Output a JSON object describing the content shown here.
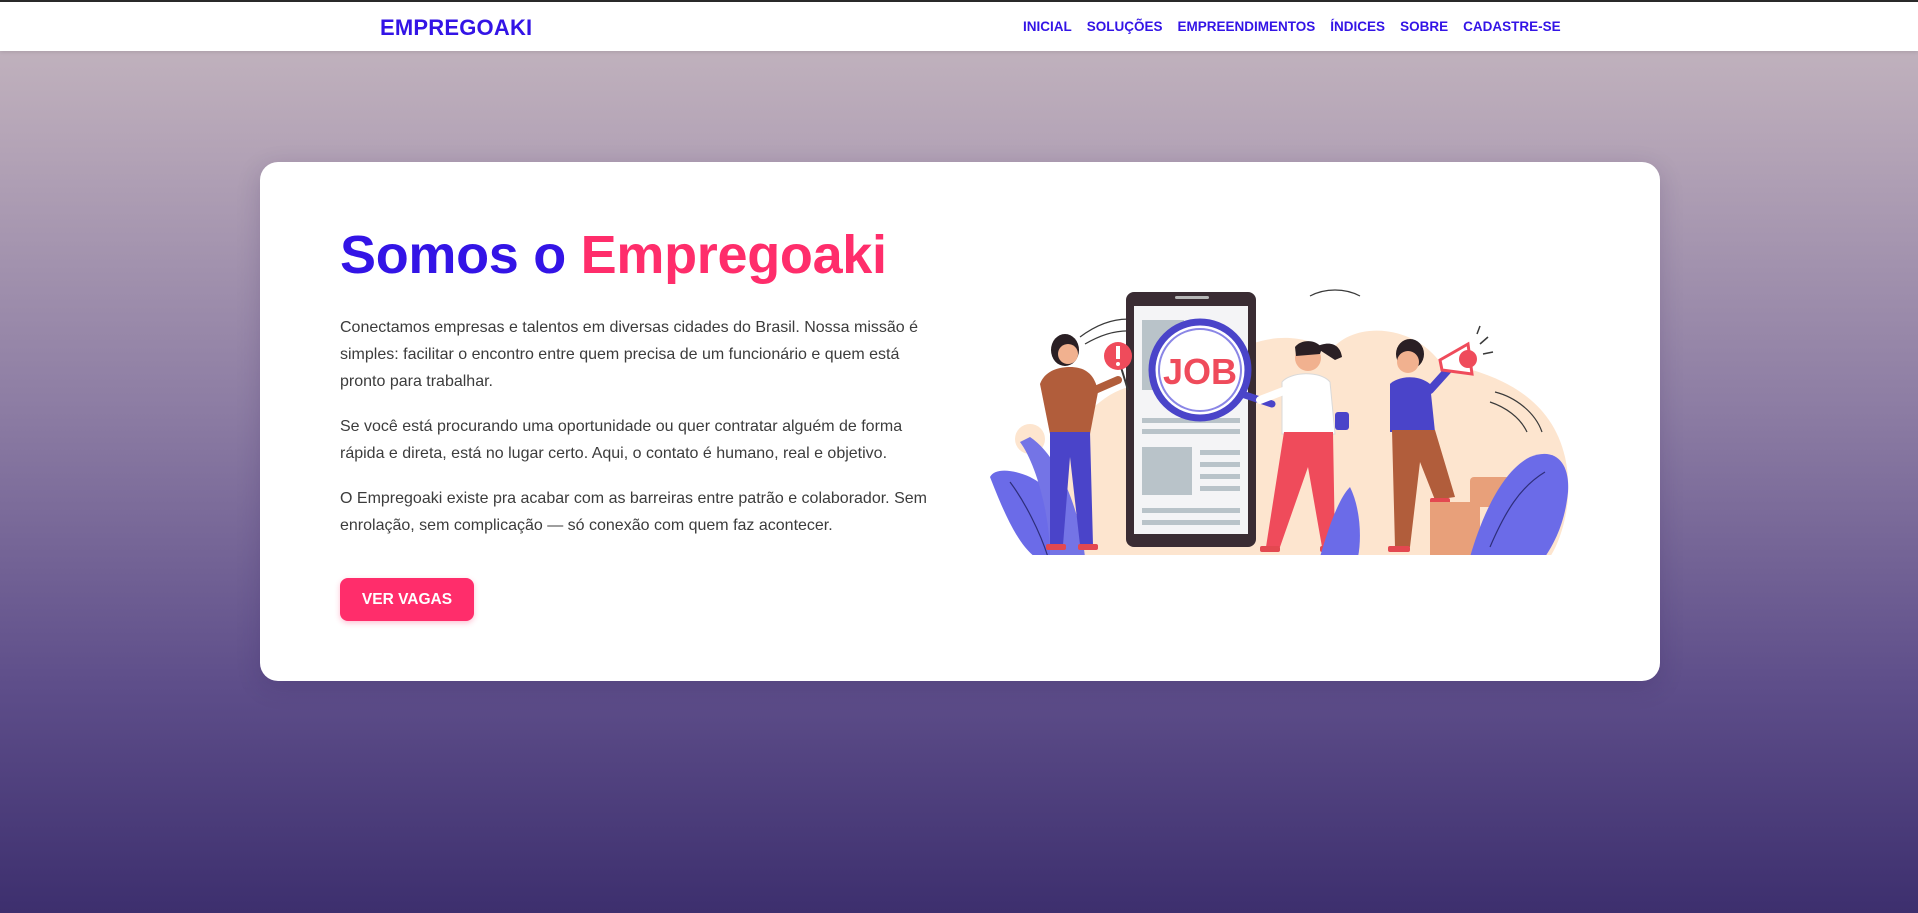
{
  "header": {
    "brand": "EMPREGOAKI",
    "nav": [
      {
        "label": "INICIAL"
      },
      {
        "label": "SOLUÇÕES"
      },
      {
        "label": "EMPREENDIMENTOS"
      },
      {
        "label": "ÍNDICES"
      },
      {
        "label": "SOBRE"
      },
      {
        "label": "CADASTRE-SE"
      }
    ]
  },
  "hero": {
    "title_part1": "Somos o ",
    "title_part2": "Empregoaki",
    "paragraphs": [
      "Conectamos empresas e talentos em diversas cidades do Brasil. Nossa missão é simples: facilitar o encontro entre quem precisa de um funcionário e quem está pronto para trabalhar.",
      "Se você está procurando uma oportunidade ou quer contratar alguém de forma rápida e direta, está no lugar certo. Aqui, o contato é humano, real e objetivo.",
      "O Empregoaki existe pra acabar com as barreiras entre patrão e colaborador. Sem enrolação, sem complicação — só conexão com quem faz acontecer."
    ],
    "cta_label": "VER VAGAS",
    "illustration_text": "JOB"
  },
  "colors": {
    "brand_blue": "#3314e6",
    "accent_pink": "#ff2d6b",
    "bg_top": "#c6b8c0",
    "bg_bottom": "#3d2f6e"
  },
  "icons": {
    "illustration": "job-search-illustration-icon",
    "magnifier": "magnifier-icon",
    "megaphone": "megaphone-icon",
    "alert": "exclamation-icon"
  }
}
